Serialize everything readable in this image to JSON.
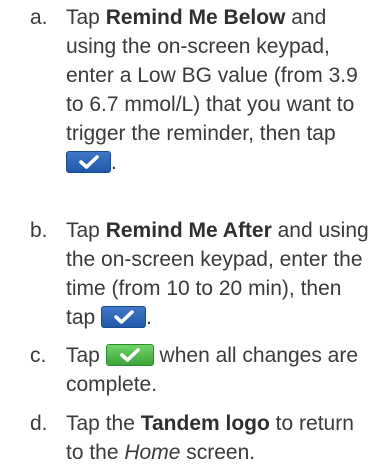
{
  "steps": [
    {
      "letter": "a.",
      "pre": "Tap ",
      "bold": "Remind Me Below",
      "post": " and using the on-screen keypad, enter a Low BG value (from 3.9 to 6.7 mmol/L) that you want to trigger the reminder, then tap",
      "after_button": ".",
      "button": {
        "icon": "check-icon",
        "color": "#2a62b4"
      }
    },
    {
      "letter": "b.",
      "pre": "Tap ",
      "bold": "Remind Me After",
      "post": " and using the on-screen keypad, enter the time (from 10 to 20 min), then tap",
      "after_button": ".",
      "button": {
        "icon": "check-icon",
        "color": "#2a62b4"
      }
    },
    {
      "letter": "c.",
      "pre": "Tap",
      "post": "when all changes are complete.",
      "button": {
        "icon": "check-icon",
        "color": "#4cbc48"
      }
    },
    {
      "letter": "d.",
      "pre": "Tap the ",
      "bold": "Tandem logo",
      "post": " to return to the ",
      "italic": "Home",
      "tail": " screen."
    }
  ]
}
